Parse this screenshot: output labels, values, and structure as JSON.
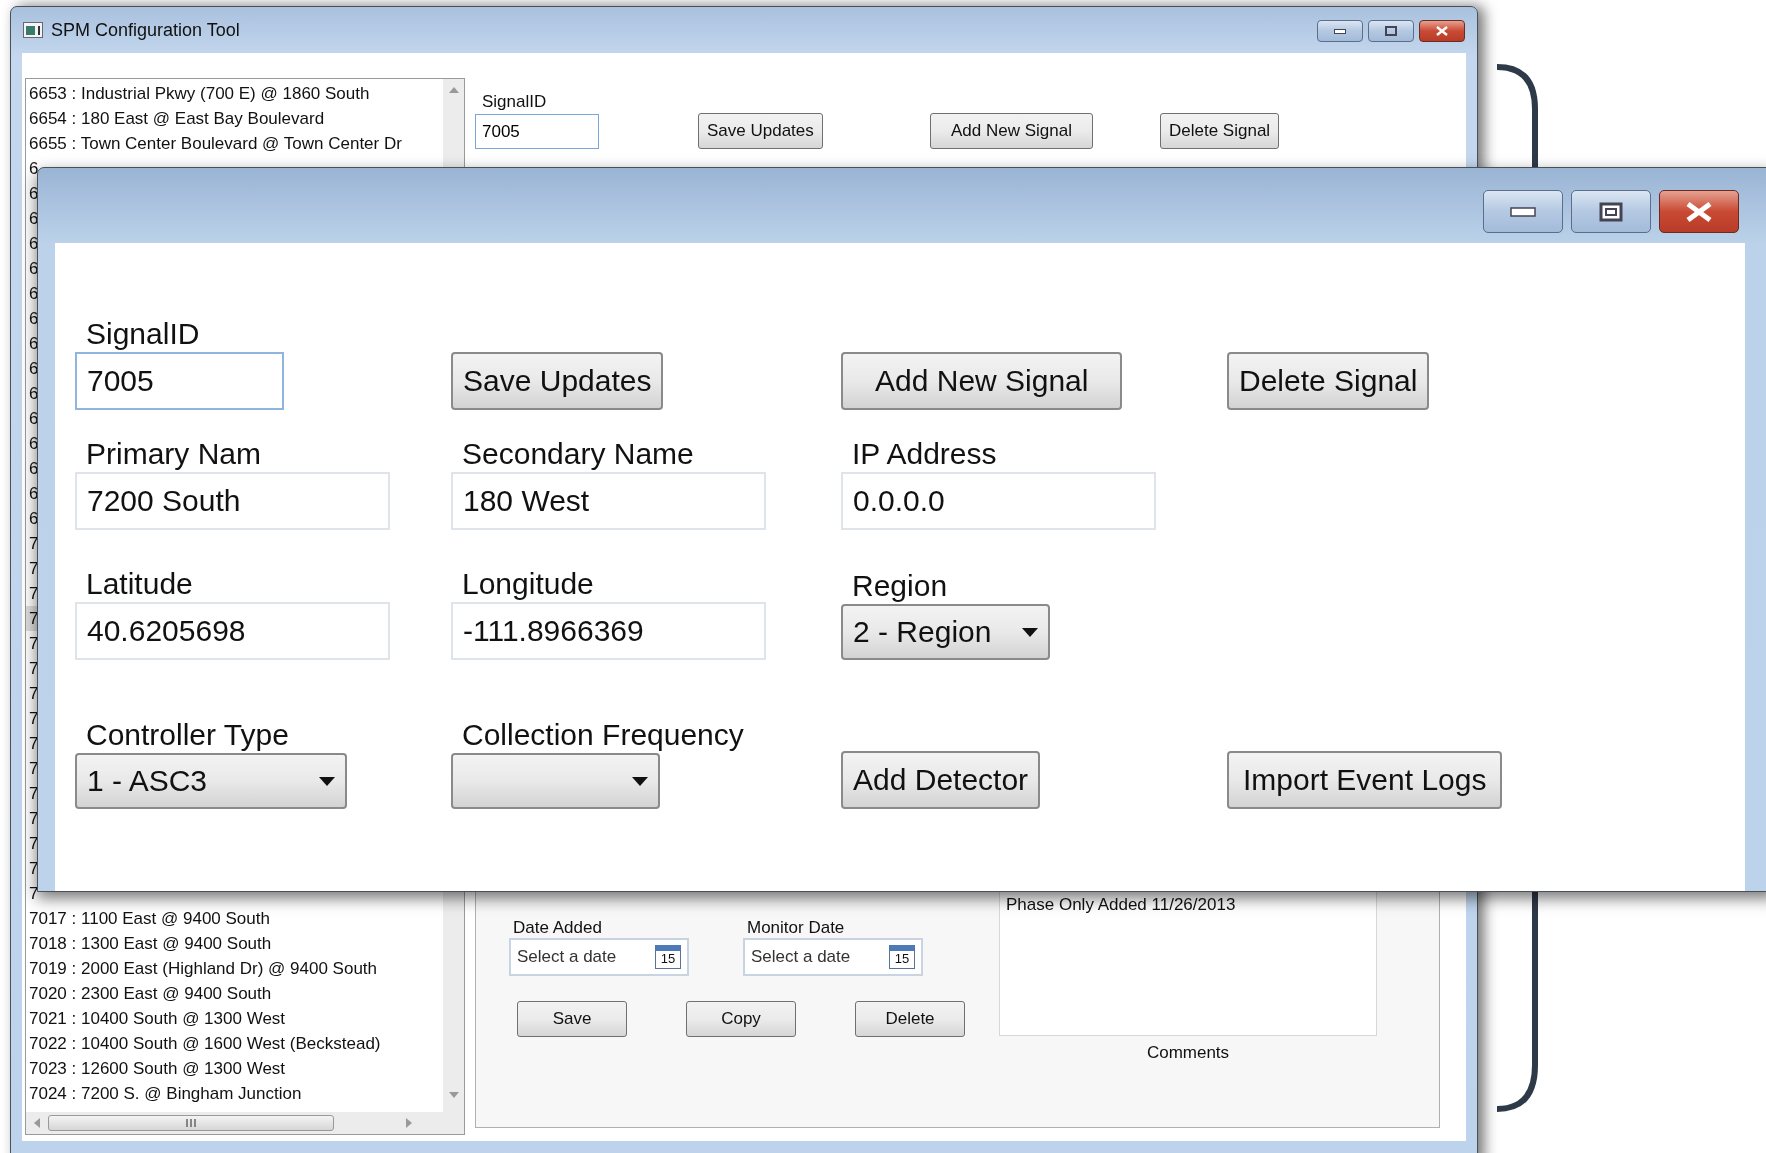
{
  "background_window": {
    "title": "SPM Configuration Tool",
    "signal_list": {
      "items": [
        {
          "text": "6653 : Industrial Pkwy (700 E) @ 1860 South",
          "selected": false
        },
        {
          "text": "6654 : 180 East @ East Bay Boulevard",
          "selected": false
        },
        {
          "text": "6655 : Town Center Boulevard @ Town Center Dr",
          "selected": false
        },
        {
          "text": "6",
          "selected": false
        },
        {
          "text": "6",
          "selected": false
        },
        {
          "text": "6",
          "selected": false
        },
        {
          "text": "6",
          "selected": false
        },
        {
          "text": "6",
          "selected": false
        },
        {
          "text": "6",
          "selected": false
        },
        {
          "text": "6",
          "selected": false
        },
        {
          "text": "6",
          "selected": false
        },
        {
          "text": "6",
          "selected": false
        },
        {
          "text": "6",
          "selected": false
        },
        {
          "text": "6",
          "selected": false
        },
        {
          "text": "6",
          "selected": false
        },
        {
          "text": "6",
          "selected": false
        },
        {
          "text": "6",
          "selected": false
        },
        {
          "text": "6",
          "selected": false
        },
        {
          "text": "7",
          "selected": false
        },
        {
          "text": "7",
          "selected": false
        },
        {
          "text": "7",
          "selected": false
        },
        {
          "text": "7",
          "selected": true
        },
        {
          "text": "7",
          "selected": false
        },
        {
          "text": "7",
          "selected": false
        },
        {
          "text": "7",
          "selected": false
        },
        {
          "text": "7",
          "selected": false
        },
        {
          "text": "7",
          "selected": false
        },
        {
          "text": "7",
          "selected": false
        },
        {
          "text": "7",
          "selected": false
        },
        {
          "text": "7",
          "selected": false
        },
        {
          "text": "7",
          "selected": false
        },
        {
          "text": "7",
          "selected": false
        },
        {
          "text": "7",
          "selected": false
        },
        {
          "text": "7017 : 1100 East @ 9400 South",
          "selected": false
        },
        {
          "text": "7018 : 1300 East @ 9400 South",
          "selected": false
        },
        {
          "text": "7019 : 2000 East (Highland Dr) @ 9400 South",
          "selected": false
        },
        {
          "text": "7020 : 2300 East @ 9400 South",
          "selected": false
        },
        {
          "text": "7021 : 10400 South @ 1300 West",
          "selected": false
        },
        {
          "text": "7022 : 10400 South @ 1600 West (Beckstead)",
          "selected": false
        },
        {
          "text": "7023 : 12600 South @ 1300 West",
          "selected": false
        },
        {
          "text": "7024 : 7200 S. @ Bingham Junction",
          "selected": false
        }
      ]
    },
    "signal_id": {
      "label": "SignalID",
      "value": "7005"
    },
    "buttons": [
      "Save Updates",
      "Add New Signal",
      "Delete Signal"
    ],
    "detail_panel": {
      "date_fields": [
        {
          "label": "Date Added",
          "placeholder": "Select a date",
          "calendar_day": "15"
        },
        {
          "label": "Monitor Date",
          "placeholder": "Select a date",
          "calendar_day": "15"
        }
      ],
      "buttons": [
        "Save",
        "Copy",
        "Delete"
      ],
      "comments": {
        "value": "Phase Only Added 11/26/2013",
        "label": "Comments"
      }
    }
  },
  "zoomed_window": {
    "rows": [
      [
        {
          "kind": "text",
          "label": "SignalID",
          "value": "7005"
        },
        {
          "kind": "button",
          "label": "Save Updates"
        },
        {
          "kind": "button",
          "label": "Add New Signal"
        },
        {
          "kind": "button",
          "label": "Delete Signal"
        }
      ],
      [
        {
          "kind": "text",
          "label": "Primary Nam",
          "value": "7200 South"
        },
        {
          "kind": "text",
          "label": "Secondary Name",
          "value": "180 West"
        },
        {
          "kind": "text",
          "label": "IP Address",
          "value": "0.0.0.0"
        }
      ],
      [
        {
          "kind": "text",
          "label": "Latitude",
          "value": "40.6205698"
        },
        {
          "kind": "text",
          "label": "Longitude",
          "value": "-111.8966369"
        },
        {
          "kind": "combo",
          "label": "Region",
          "value": "2 - Region"
        }
      ],
      [
        {
          "kind": "combo",
          "label": "Controller Type",
          "value": "1 - ASC3"
        },
        {
          "kind": "combo",
          "label": "Collection Frequency"
        },
        {
          "kind": "button",
          "label": "Add Detector"
        },
        {
          "kind": "button",
          "label": "Import Event Logs"
        }
      ]
    ]
  }
}
